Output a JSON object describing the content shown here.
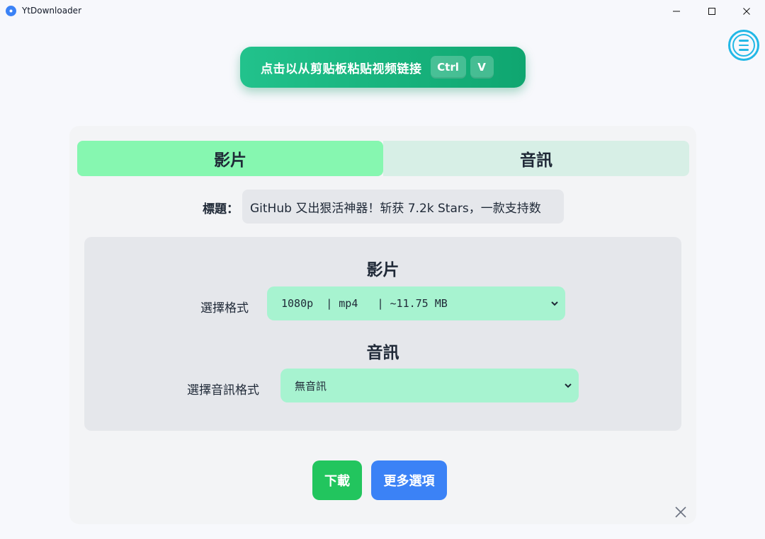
{
  "window": {
    "title": "YtDownloader"
  },
  "paste_button": {
    "label": "点击以从剪贴板粘贴视频链接",
    "keys": [
      "Ctrl",
      "V"
    ]
  },
  "tabs": [
    {
      "label": "影片",
      "active": true
    },
    {
      "label": "音訊",
      "active": false
    }
  ],
  "title_field": {
    "label": "標題：",
    "value": "GitHub 又出狠活神器！斩获 7.2k Stars，一款支持数"
  },
  "video_section": {
    "heading": "影片",
    "format_label": "選擇格式",
    "selected_format": "1080p  | mp4   | ~11.75 MB"
  },
  "audio_section": {
    "heading": "音訊",
    "format_label": "選擇音訊格式",
    "selected_format": "無音訊"
  },
  "actions": {
    "download_label": "下載",
    "more_options_label": "更多選項"
  },
  "colors": {
    "accent_green": "#22c55e",
    "accent_blue": "#3b82f6",
    "tab_active": "#86f7b0",
    "select_bg": "#a7f3d0",
    "menu_icon": "#22b8e6"
  },
  "icons": {
    "app": "app-logo-icon",
    "menu": "hamburger-menu-icon",
    "dropdown": "chevron-down-icon",
    "dismiss": "close-icon"
  }
}
